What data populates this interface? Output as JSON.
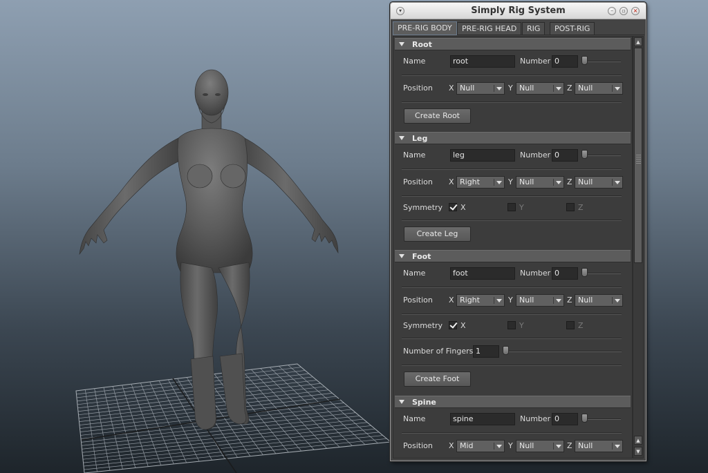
{
  "window": {
    "title": "Simply Rig System"
  },
  "tabs": [
    {
      "label": "PRE-RIG BODY",
      "active": true
    },
    {
      "label": "PRE-RIG HEAD",
      "active": false
    },
    {
      "label": "RIG",
      "active": false
    },
    {
      "label": "POST-RIG",
      "active": false
    }
  ],
  "labels": {
    "name": "Name",
    "number": "Number",
    "position": "Position",
    "symmetry": "Symmetry",
    "x": "X",
    "y": "Y",
    "z": "Z",
    "number_of_fingers": "Number of Fingers"
  },
  "sections": {
    "root": {
      "title": "Root",
      "name_value": "root",
      "number_value": "0",
      "number_slider": 0,
      "position": {
        "x": "Null",
        "y": "Null",
        "z": "Null"
      },
      "button": "Create Root"
    },
    "leg": {
      "title": "Leg",
      "name_value": "leg",
      "number_value": "0",
      "number_slider": 0,
      "position": {
        "x": "Right",
        "y": "Null",
        "z": "Null"
      },
      "symmetry": {
        "x": true,
        "y": false,
        "z": false
      },
      "button": "Create Leg"
    },
    "foot": {
      "title": "Foot",
      "name_value": "foot",
      "number_value": "0",
      "number_slider": 0,
      "position": {
        "x": "Right",
        "y": "Null",
        "z": "Null"
      },
      "symmetry": {
        "x": true,
        "y": false,
        "z": false
      },
      "fingers_value": "1",
      "fingers_slider": 0,
      "button": "Create Foot"
    },
    "spine": {
      "title": "Spine",
      "name_value": "spine",
      "number_value": "0",
      "number_slider": 0,
      "position": {
        "x": "Mid",
        "y": "Null",
        "z": "Null"
      }
    }
  },
  "icons": {
    "window_menu": "chevron-down-icon",
    "minimize": "minimize-icon",
    "maximize": "maximize-icon",
    "close": "close-icon",
    "scroll_up": "scroll-up-icon",
    "scroll_down": "scroll-down-icon"
  },
  "colors": {
    "panel_bg": "#444444",
    "frame_header": "#5c5c5c",
    "field_bg": "#2b2b2b",
    "viewport_top": "#8e9fb1",
    "viewport_bottom": "#1e252b",
    "model_gray": "#5a5a5a"
  }
}
